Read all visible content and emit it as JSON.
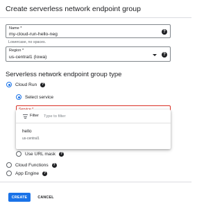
{
  "page": {
    "title": "Create serverless network endpoint group"
  },
  "name_field": {
    "label": "Name *",
    "value": "my-cloud-run-hello-neg",
    "hint": "Lowercase, no spaces."
  },
  "region_field": {
    "label": "Region *",
    "value": "us-central1 (Iowa)"
  },
  "section": {
    "title": "Serverless network endpoint group type"
  },
  "types": {
    "cloud_run": {
      "label": "Cloud Run",
      "selected": true
    },
    "select_service": {
      "label": "Select service",
      "selected": true
    },
    "url_mask": {
      "label": "Use URL mask",
      "selected": false
    },
    "cloud_functions": {
      "label": "Cloud Functions",
      "selected": false
    },
    "app_engine": {
      "label": "App Engine",
      "selected": false
    }
  },
  "service_field": {
    "label": "Service *"
  },
  "dropdown": {
    "filter_label": "Filter",
    "filter_placeholder": "Type to filter",
    "options": [
      {
        "name": "hello",
        "region": "us-central1"
      }
    ]
  },
  "icons": {
    "help": "help-icon",
    "caret": "dropdown-caret-icon",
    "filter": "filter-list-icon"
  },
  "actions": {
    "create_label": "CREATE",
    "cancel_label": "CANCEL"
  },
  "colors": {
    "primary": "#1a73e8",
    "error": "#d93025",
    "text": "#202124",
    "secondary_text": "#5f6368"
  }
}
